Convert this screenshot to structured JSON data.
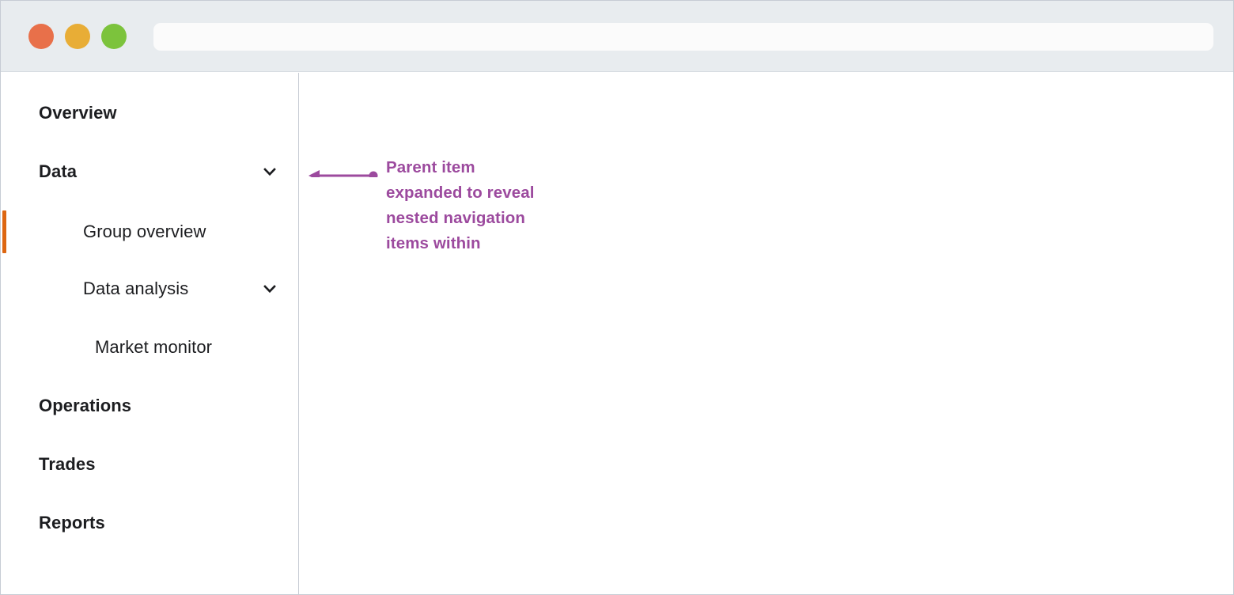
{
  "window": {
    "titlebar": {
      "traffic_lights": [
        {
          "name": "close",
          "color": "#e8704a"
        },
        {
          "name": "minimize",
          "color": "#e8ad36"
        },
        {
          "name": "maximize",
          "color": "#7cc33c"
        }
      ],
      "address_bar": {
        "value": "",
        "placeholder": ""
      }
    }
  },
  "sidebar": {
    "items": [
      {
        "label": "Overview",
        "level": 0,
        "chevron": null,
        "active": false
      },
      {
        "label": "Data",
        "level": 0,
        "chevron": "chevron-down-icon",
        "active": false
      },
      {
        "label": "Group overview",
        "level": 1,
        "chevron": null,
        "active": true
      },
      {
        "label": "Data analysis",
        "level": 1,
        "chevron": "chevron-down-icon",
        "active": false
      },
      {
        "label": "Market monitor",
        "level": 2,
        "chevron": null,
        "active": false
      },
      {
        "label": "Operations",
        "level": 0,
        "chevron": null,
        "active": false
      },
      {
        "label": "Trades",
        "level": 0,
        "chevron": null,
        "active": false
      },
      {
        "label": "Reports",
        "level": 0,
        "chevron": null,
        "active": false
      }
    ],
    "active_indicator_color": "#dd6611"
  },
  "annotation": {
    "text": "Parent item expanded to reveal nested navigation items within",
    "color": "#9c4a9e",
    "arrow_direction": "left"
  }
}
